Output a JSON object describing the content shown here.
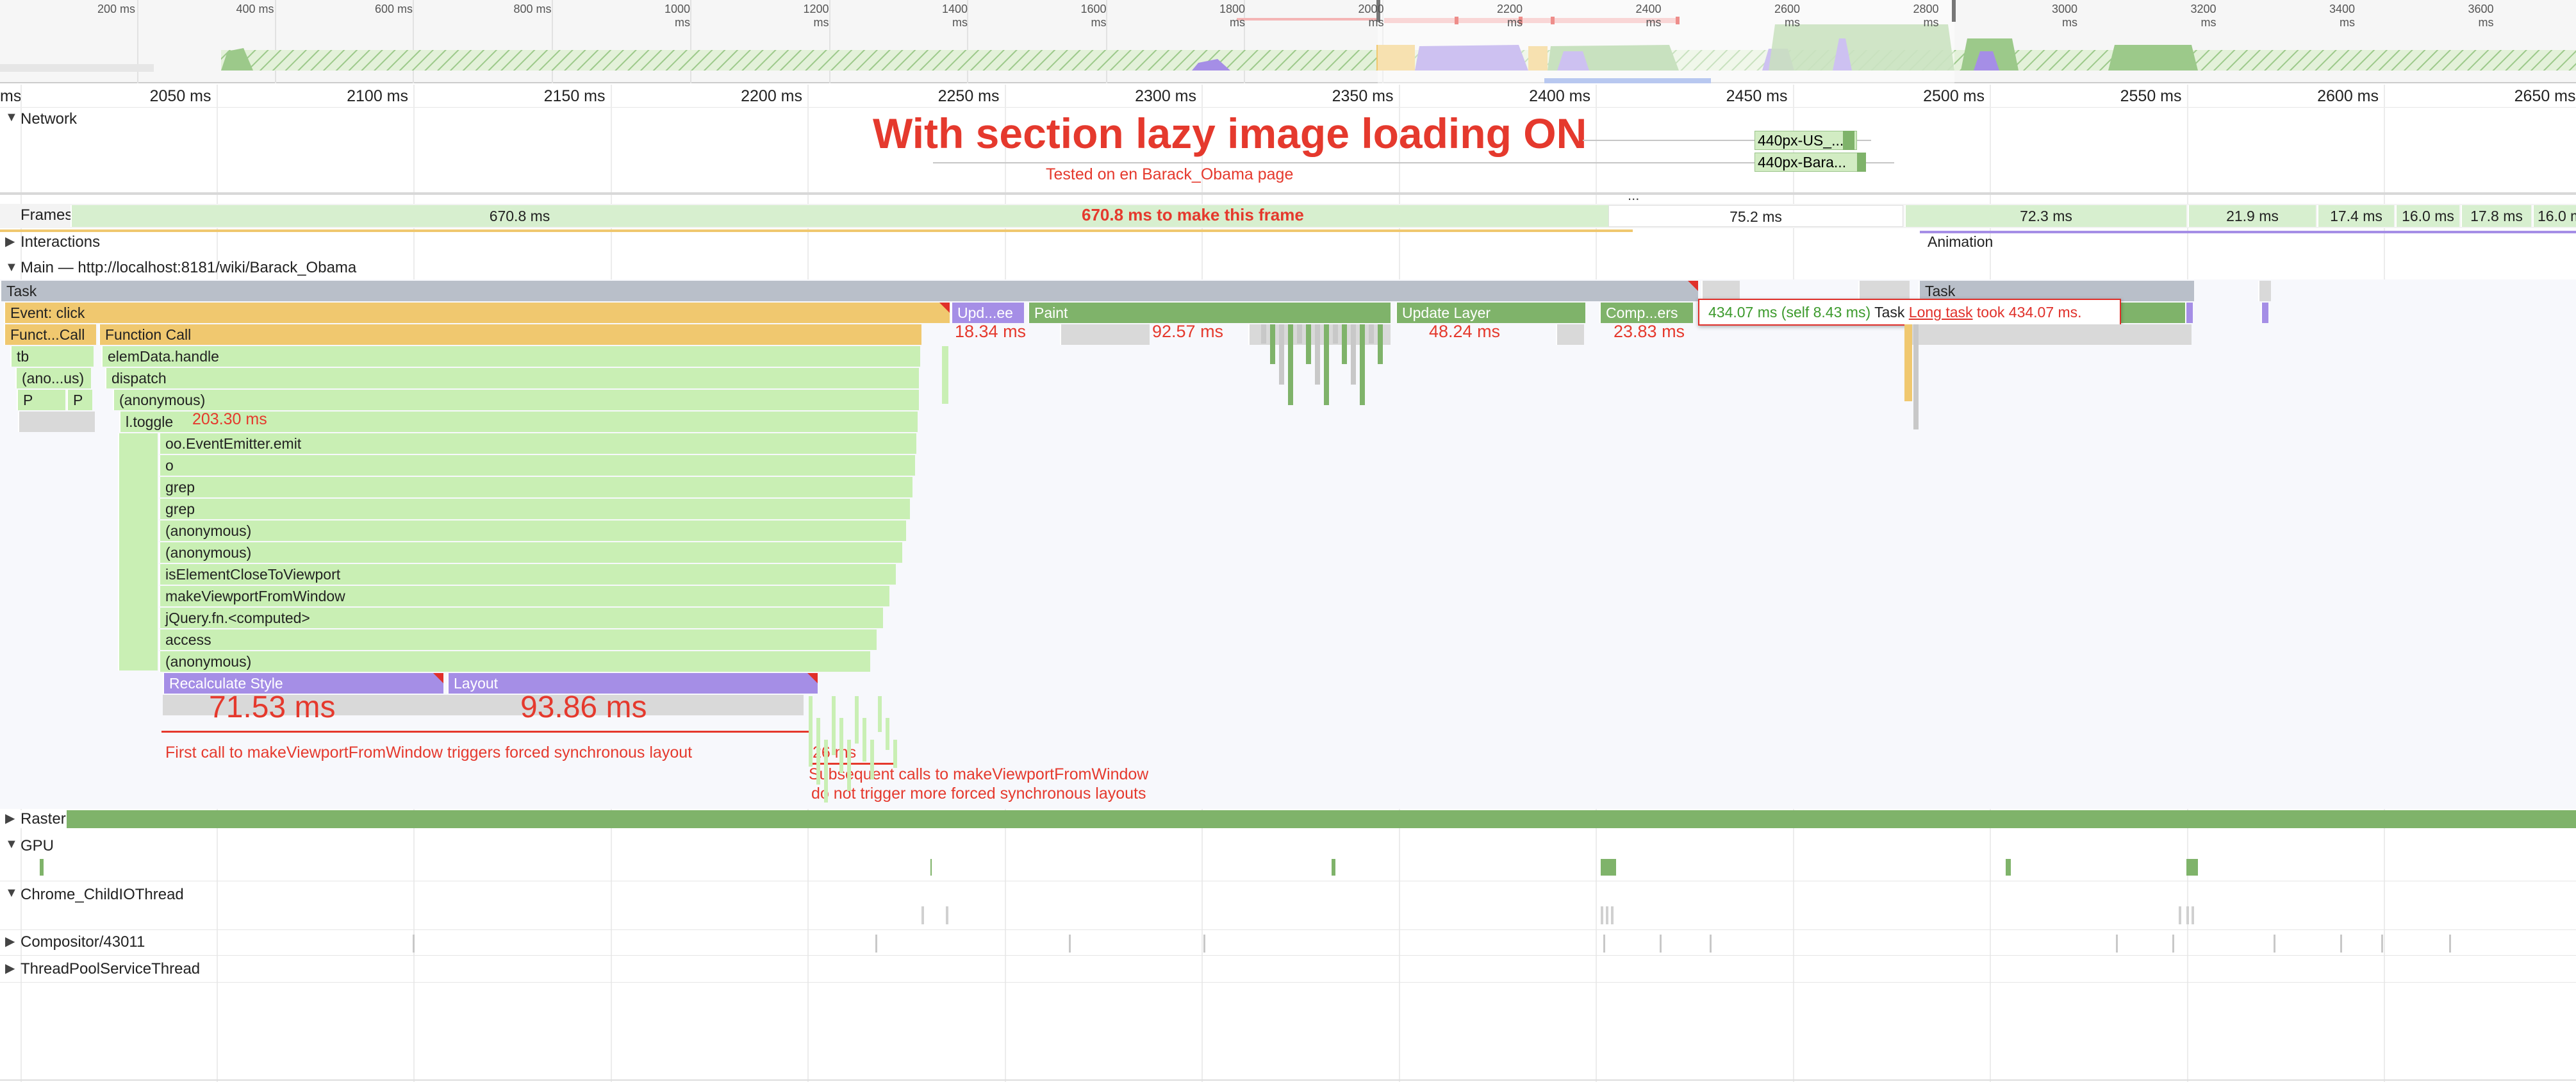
{
  "overview": {
    "ticks": [
      "200 ms",
      "400 ms",
      "600 ms",
      "800 ms",
      "1000 ms",
      "1200 ms",
      "1400 ms",
      "1600 ms",
      "1800 ms",
      "2000 ms",
      "2200 ms",
      "2400 ms",
      "2600 ms",
      "2800 ms",
      "3000 ms",
      "3200 ms",
      "3400 ms",
      "3600 ms"
    ]
  },
  "ruler": {
    "ticks": [
      "ms",
      "2050 ms",
      "2100 ms",
      "2150 ms",
      "2200 ms",
      "2250 ms",
      "2300 ms",
      "2350 ms",
      "2400 ms",
      "2450 ms",
      "2500 ms",
      "2550 ms",
      "2600 ms",
      "2650 ms"
    ]
  },
  "tracks": {
    "network": "Network",
    "frames": "Frames",
    "interactions": "Interactions",
    "main": "Main — http://localhost:8181/wiki/Barack_Obama",
    "raster": "Raster",
    "gpu": "GPU",
    "io": "Chrome_ChildIOThread",
    "compositor": "Compositor/43011",
    "threadpool": "ThreadPoolServiceThread"
  },
  "network": {
    "req1": "440px-US_...",
    "req2": "440px-Bara..."
  },
  "annotations": {
    "headline": "With section lazy image loading ON",
    "subhead": "Tested on en Barack_Obama page",
    "frame_note": "670.8 ms to make this frame",
    "toggle_ms": "203.30 ms",
    "recalc_ms": "71.53 ms",
    "layout_ms": "93.86 ms",
    "forced_layout": "First call to makeViewportFromWindow triggers forced synchronous layout",
    "small_ms": "26 ms",
    "subsequent_1": "Subsequent calls to makeViewportFromWindow",
    "subsequent_2": "do not trigger more forced synchronous layouts",
    "update_ms": "18.34 ms",
    "paint_ms": "92.57 ms",
    "updatelayer_ms": "48.24 ms",
    "composite_ms": "23.83 ms"
  },
  "frames": {
    "f1": "670.8 ms",
    "f2": "75.2 ms",
    "f3": "72.3 ms",
    "f4": "21.9 ms",
    "f5": "17.4 ms",
    "f6": "16.0 ms",
    "f7": "17.8 ms",
    "f8": "16.0 ms",
    "ellipsis": "..."
  },
  "interactions": {
    "animation": "Animation"
  },
  "flame": {
    "task": "Task",
    "task2": "Task",
    "event_click": "Event: click",
    "funct_call": "Funct...Call",
    "function_call": "Function Call",
    "tb": "tb",
    "elemdata": "elemData.handle",
    "anous": "(ano...us)",
    "dispatch": "dispatch",
    "p1": "P",
    "p2": "P",
    "anonymous1": "(anonymous)",
    "ltoggle": "l.toggle",
    "emit": "oo.EventEmitter.emit",
    "o": "o",
    "grep1": "grep",
    "grep2": "grep",
    "anonymous2": "(anonymous)",
    "anonymous3": "(anonymous)",
    "isclose": "isElementCloseToViewport",
    "makeviewport": "makeViewportFromWindow",
    "jquery": "jQuery.fn.<computed>",
    "access": "access",
    "anonymous4": "(anonymous)",
    "recalc": "Recalculate Style",
    "layout": "Layout",
    "update": "Upd...ee",
    "paint": "Paint",
    "updatelayer": "Update Layer",
    "composite": "Comp...ers"
  },
  "tooltip": {
    "time": "434.07 ms (self 8.43 ms)",
    "task": "Task",
    "longtask": "Long task",
    "took": "took 434.07 ms."
  },
  "colors": {
    "yellow": "#f0c86f",
    "green_light": "#c9efb4",
    "green_dark": "#7fb36a",
    "purple": "#a58ee6",
    "annotation_red": "#e5392d"
  }
}
